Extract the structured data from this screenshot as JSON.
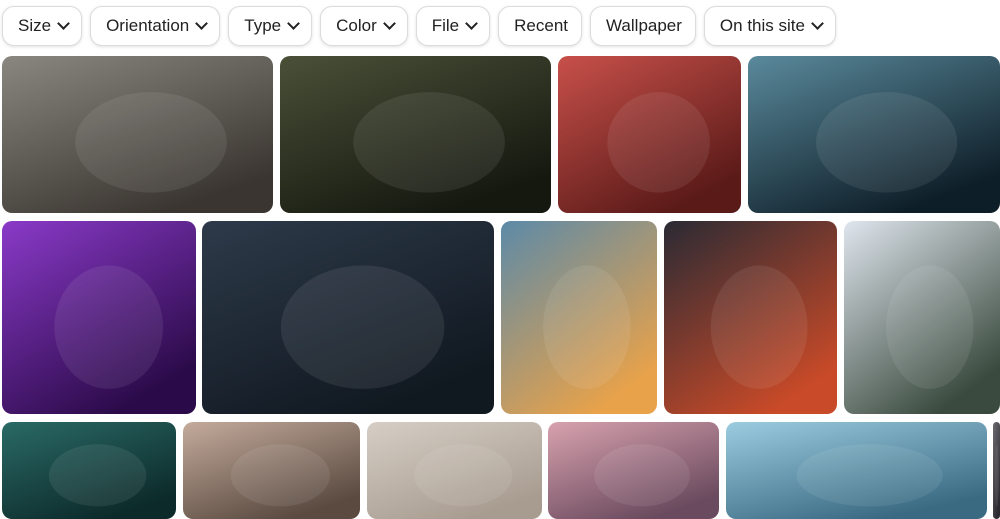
{
  "filters": [
    {
      "label": "Size",
      "has_dropdown": true
    },
    {
      "label": "Orientation",
      "has_dropdown": true
    },
    {
      "label": "Type",
      "has_dropdown": true
    },
    {
      "label": "Color",
      "has_dropdown": true
    },
    {
      "label": "File",
      "has_dropdown": true
    },
    {
      "label": "Recent",
      "has_dropdown": false
    },
    {
      "label": "Wallpaper",
      "has_dropdown": false
    },
    {
      "label": "On this site",
      "has_dropdown": true
    }
  ],
  "images": [
    {
      "name": "image-boy-with-flowers",
      "colors": [
        "#8a8780",
        "#3a3530"
      ]
    },
    {
      "name": "image-hand-yellow-flower-field",
      "colors": [
        "#4a5038",
        "#15180f"
      ]
    },
    {
      "name": "image-hand-red-blinds",
      "colors": [
        "#c8504a",
        "#5a1a18"
      ]
    },
    {
      "name": "image-silhouette-blue-room",
      "colors": [
        "#5a8a9c",
        "#0e1e28"
      ]
    },
    {
      "name": "image-purple-train-clouds",
      "colors": [
        "#8a3ac8",
        "#2a0a48"
      ]
    },
    {
      "name": "image-back-among-leaves",
      "colors": [
        "#2e3a4a",
        "#101820"
      ]
    },
    {
      "name": "image-clouds-over-city",
      "colors": [
        "#5c8aa8",
        "#e8a24a"
      ]
    },
    {
      "name": "image-hands-red-sunset-sky",
      "colors": [
        "#2a2a34",
        "#c84a28"
      ]
    },
    {
      "name": "image-man-white-shirt-flowers",
      "colors": [
        "#dfe6ee",
        "#3a4a3e"
      ]
    },
    {
      "name": "image-hands-green-water",
      "colors": [
        "#2a6a66",
        "#0c2a2a"
      ]
    },
    {
      "name": "image-sun-over-street",
      "colors": [
        "#c4ab9c",
        "#5a4a40"
      ]
    },
    {
      "name": "image-hands-beige-background",
      "colors": [
        "#d6cec6",
        "#a89c90"
      ]
    },
    {
      "name": "image-pink-clouds",
      "colors": [
        "#d8a2ae",
        "#6a4a5e"
      ]
    },
    {
      "name": "image-hands-broken-glass",
      "colors": [
        "#9ccce0",
        "#3a6a82"
      ]
    },
    {
      "name": "image-partial-edge",
      "colors": [
        "#6a6a70",
        "#2a2a30"
      ]
    }
  ]
}
